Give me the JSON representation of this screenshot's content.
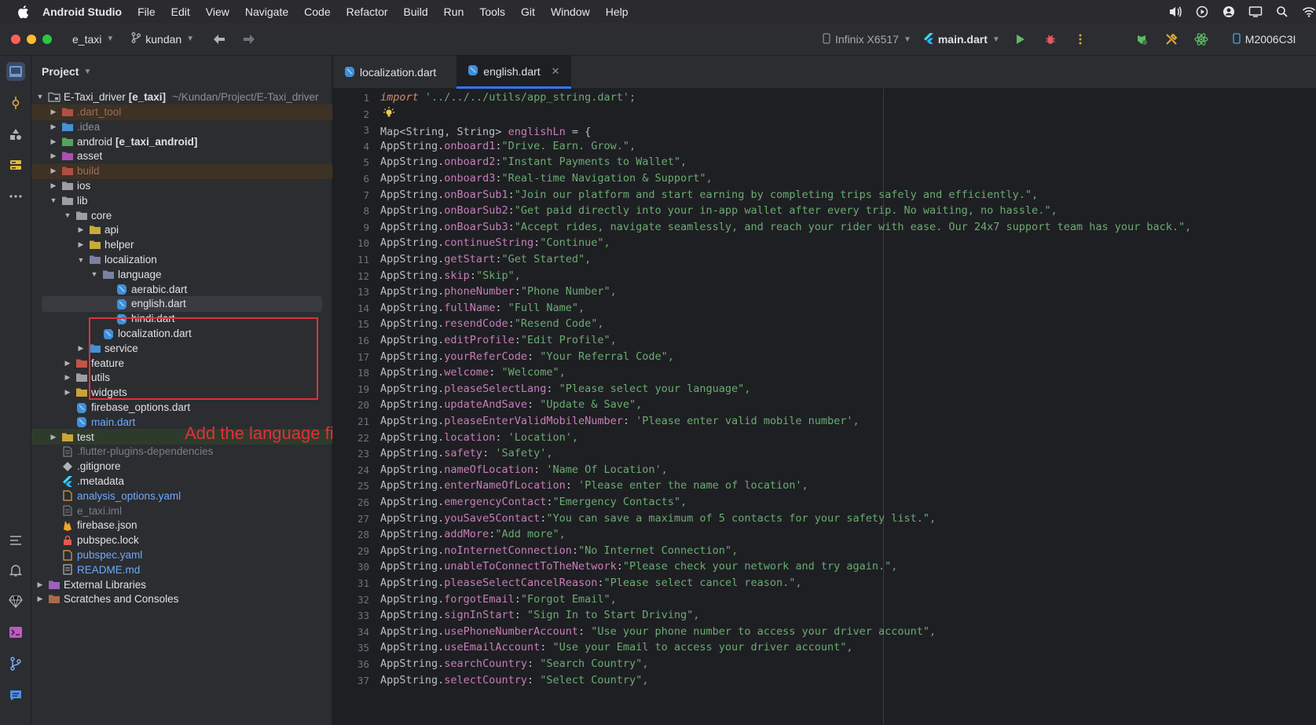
{
  "menubar": {
    "app_name": "Android Studio",
    "items": [
      "File",
      "Edit",
      "View",
      "Navigate",
      "Code",
      "Refactor",
      "Build",
      "Run",
      "Tools",
      "Git",
      "Window",
      "Help"
    ]
  },
  "toolbar": {
    "project_name": "e_taxi",
    "branch": "kundan",
    "device": "Infinix X6517",
    "run_config": "main.dart",
    "device_manager": "M2006C3I"
  },
  "project_panel": {
    "title": "Project",
    "root_name": "E-Taxi_driver",
    "root_module": "[e_taxi]",
    "root_path": "~/Kundan/Project/E-Taxi_driver",
    "tree": [
      {
        "label": ".dart_tool",
        "level": 1,
        "arrow": "right",
        "style": "excluded",
        "hl": "brown"
      },
      {
        "label": ".idea",
        "level": 1,
        "arrow": "right",
        "style": "muted"
      },
      {
        "label": "android",
        "suffix": "[e_taxi_android]",
        "level": 1,
        "arrow": "right"
      },
      {
        "label": "asset",
        "level": 1,
        "arrow": "right"
      },
      {
        "label": "build",
        "level": 1,
        "arrow": "right",
        "style": "excluded",
        "hl": "brown"
      },
      {
        "label": "ios",
        "level": 1,
        "arrow": "right"
      },
      {
        "label": "lib",
        "level": 1,
        "arrow": "down"
      },
      {
        "label": "core",
        "level": 2,
        "arrow": "down"
      },
      {
        "label": "api",
        "level": 3,
        "arrow": "right"
      },
      {
        "label": "helper",
        "level": 3,
        "arrow": "right"
      },
      {
        "label": "localization",
        "level": 3,
        "arrow": "down"
      },
      {
        "label": "language",
        "level": 4,
        "arrow": "down"
      },
      {
        "label": "aerabic.dart",
        "level": 5,
        "arrow": ""
      },
      {
        "label": "english.dart",
        "level": 5,
        "arrow": "",
        "selected": true
      },
      {
        "label": "hindi.dart",
        "level": 5,
        "arrow": ""
      },
      {
        "label": "localization.dart",
        "level": 4,
        "arrow": ""
      },
      {
        "label": "service",
        "level": 3,
        "arrow": "right"
      },
      {
        "label": "feature",
        "level": 2,
        "arrow": "right"
      },
      {
        "label": "utils",
        "level": 2,
        "arrow": "right"
      },
      {
        "label": "widgets",
        "level": 2,
        "arrow": "right"
      },
      {
        "label": "firebase_options.dart",
        "level": 2,
        "arrow": ""
      },
      {
        "label": "main.dart",
        "level": 2,
        "arrow": "",
        "style": "linkblue"
      },
      {
        "label": "test",
        "level": 1,
        "arrow": "right",
        "hl": "green"
      },
      {
        "label": ".flutter-plugins-dependencies",
        "level": 1,
        "arrow": "",
        "style": "grey"
      },
      {
        "label": ".gitignore",
        "level": 1,
        "arrow": ""
      },
      {
        "label": ".metadata",
        "level": 1,
        "arrow": ""
      },
      {
        "label": "analysis_options.yaml",
        "level": 1,
        "arrow": "",
        "style": "linkblue"
      },
      {
        "label": "e_taxi.iml",
        "level": 1,
        "arrow": "",
        "style": "grey"
      },
      {
        "label": "firebase.json",
        "level": 1,
        "arrow": ""
      },
      {
        "label": "pubspec.lock",
        "level": 1,
        "arrow": ""
      },
      {
        "label": "pubspec.yaml",
        "level": 1,
        "arrow": "",
        "style": "linkblue"
      },
      {
        "label": "README.md",
        "level": 1,
        "arrow": "",
        "style": "linkblue"
      },
      {
        "label": "External Libraries",
        "level": 0,
        "arrow": "right"
      },
      {
        "label": "Scratches and Consoles",
        "level": 0,
        "arrow": "right"
      }
    ],
    "annotation": "Add the language file"
  },
  "tabs": [
    {
      "label": "localization.dart",
      "active": false
    },
    {
      "label": "english.dart",
      "active": true
    }
  ],
  "editor": {
    "line1_kw": "import",
    "line1_str": "'../../../utils/app_string.dart';",
    "line3_type": "Map<String, String>",
    "line3_var": "englishLn",
    "line3_rest": " = {",
    "entries": [
      {
        "key": "onboard1",
        "sep": ":",
        "value": "\"Drive. Earn. Grow.\","
      },
      {
        "key": "onboard2",
        "sep": ":",
        "value": "\"Instant Payments to Wallet\","
      },
      {
        "key": "onboard3",
        "sep": ":",
        "value": "\"Real-time Navigation & Support\","
      },
      {
        "key": "onBoarSub1",
        "sep": ":",
        "value": "\"Join our platform and start earning by completing trips safely and efficiently.\","
      },
      {
        "key": "onBoarSub2",
        "sep": ":",
        "value": "\"Get paid directly into your in-app wallet after every trip. No waiting, no hassle.\","
      },
      {
        "key": "onBoarSub3",
        "sep": ":",
        "value": "\"Accept rides, navigate seamlessly, and reach your rider with ease. Our 24x7 support team has your back.\","
      },
      {
        "key": "continueString",
        "sep": ":",
        "value": "\"Continue\","
      },
      {
        "key": "getStart",
        "sep": ":",
        "value": "\"Get Started\","
      },
      {
        "key": "skip",
        "sep": ":",
        "value": "\"Skip\","
      },
      {
        "key": "phoneNumber",
        "sep": ":",
        "value": "\"Phone Number\","
      },
      {
        "key": "fullName",
        "sep": ": ",
        "value": "\"Full Name\","
      },
      {
        "key": "resendCode",
        "sep": ":",
        "value": "\"Resend Code\","
      },
      {
        "key": "editProfile",
        "sep": ":",
        "value": "\"Edit Profile\","
      },
      {
        "key": "yourReferCode",
        "sep": ": ",
        "value": "\"Your Referral Code\","
      },
      {
        "key": "welcome",
        "sep": ": ",
        "value": "\"Welcome\","
      },
      {
        "key": "pleaseSelectLang",
        "sep": ": ",
        "value": "\"Please select your language\","
      },
      {
        "key": "updateAndSave",
        "sep": ": ",
        "value": "\"Update & Save\","
      },
      {
        "key": "pleaseEnterValidMobileNumber",
        "sep": ": ",
        "value": "'Please enter valid mobile number',"
      },
      {
        "key": "location",
        "sep": ": ",
        "value": "'Location',"
      },
      {
        "key": "safety",
        "sep": ": ",
        "value": "'Safety',"
      },
      {
        "key": "nameOfLocation",
        "sep": ": ",
        "value": "'Name Of Location',"
      },
      {
        "key": "enterNameOfLocation",
        "sep": ": ",
        "value": "'Please enter the name of location',"
      },
      {
        "key": "emergencyContact",
        "sep": ":",
        "value": "\"Emergency Contacts\","
      },
      {
        "key": "youSave5Contact",
        "sep": ":",
        "value": "\"You can save a maximum of 5 contacts for your safety list.\","
      },
      {
        "key": "addMore",
        "sep": ":",
        "value": "\"Add more\","
      },
      {
        "key": "noInternetConnection",
        "sep": ":",
        "value": "\"No Internet Connection\","
      },
      {
        "key": "unableToConnectToTheNetwork",
        "sep": ":",
        "value": "\"Please check your network and try again.\","
      },
      {
        "key": "pleaseSelectCancelReason",
        "sep": ":",
        "value": "\"Please select cancel reason.\","
      },
      {
        "key": "forgotEmail",
        "sep": ":",
        "value": "\"Forgot Email\","
      },
      {
        "key": "signInStart",
        "sep": ": ",
        "value": "\"Sign In to Start Driving\","
      },
      {
        "key": "usePhoneNumberAccount",
        "sep": ": ",
        "value": "\"Use your phone number to access your driver account\","
      },
      {
        "key": "useEmailAccount",
        "sep": ": ",
        "value": "\"Use your Email to access your driver account\","
      },
      {
        "key": "searchCountry",
        "sep": ": ",
        "value": "\"Search Country\","
      },
      {
        "key": "selectCountry",
        "sep": ": ",
        "value": "\"Select Country\","
      }
    ],
    "class_prefix": "AppString",
    "line_numbers": [
      "1",
      "2",
      "3",
      "4",
      "5",
      "6",
      "7",
      "8",
      "9",
      "10",
      "11",
      "12",
      "13",
      "14",
      "15",
      "16",
      "17",
      "18",
      "19",
      "20",
      "21",
      "22",
      "23",
      "24",
      "25",
      "26",
      "27",
      "28",
      "29",
      "30",
      "31",
      "32",
      "33",
      "34",
      "35",
      "36",
      "37"
    ]
  }
}
